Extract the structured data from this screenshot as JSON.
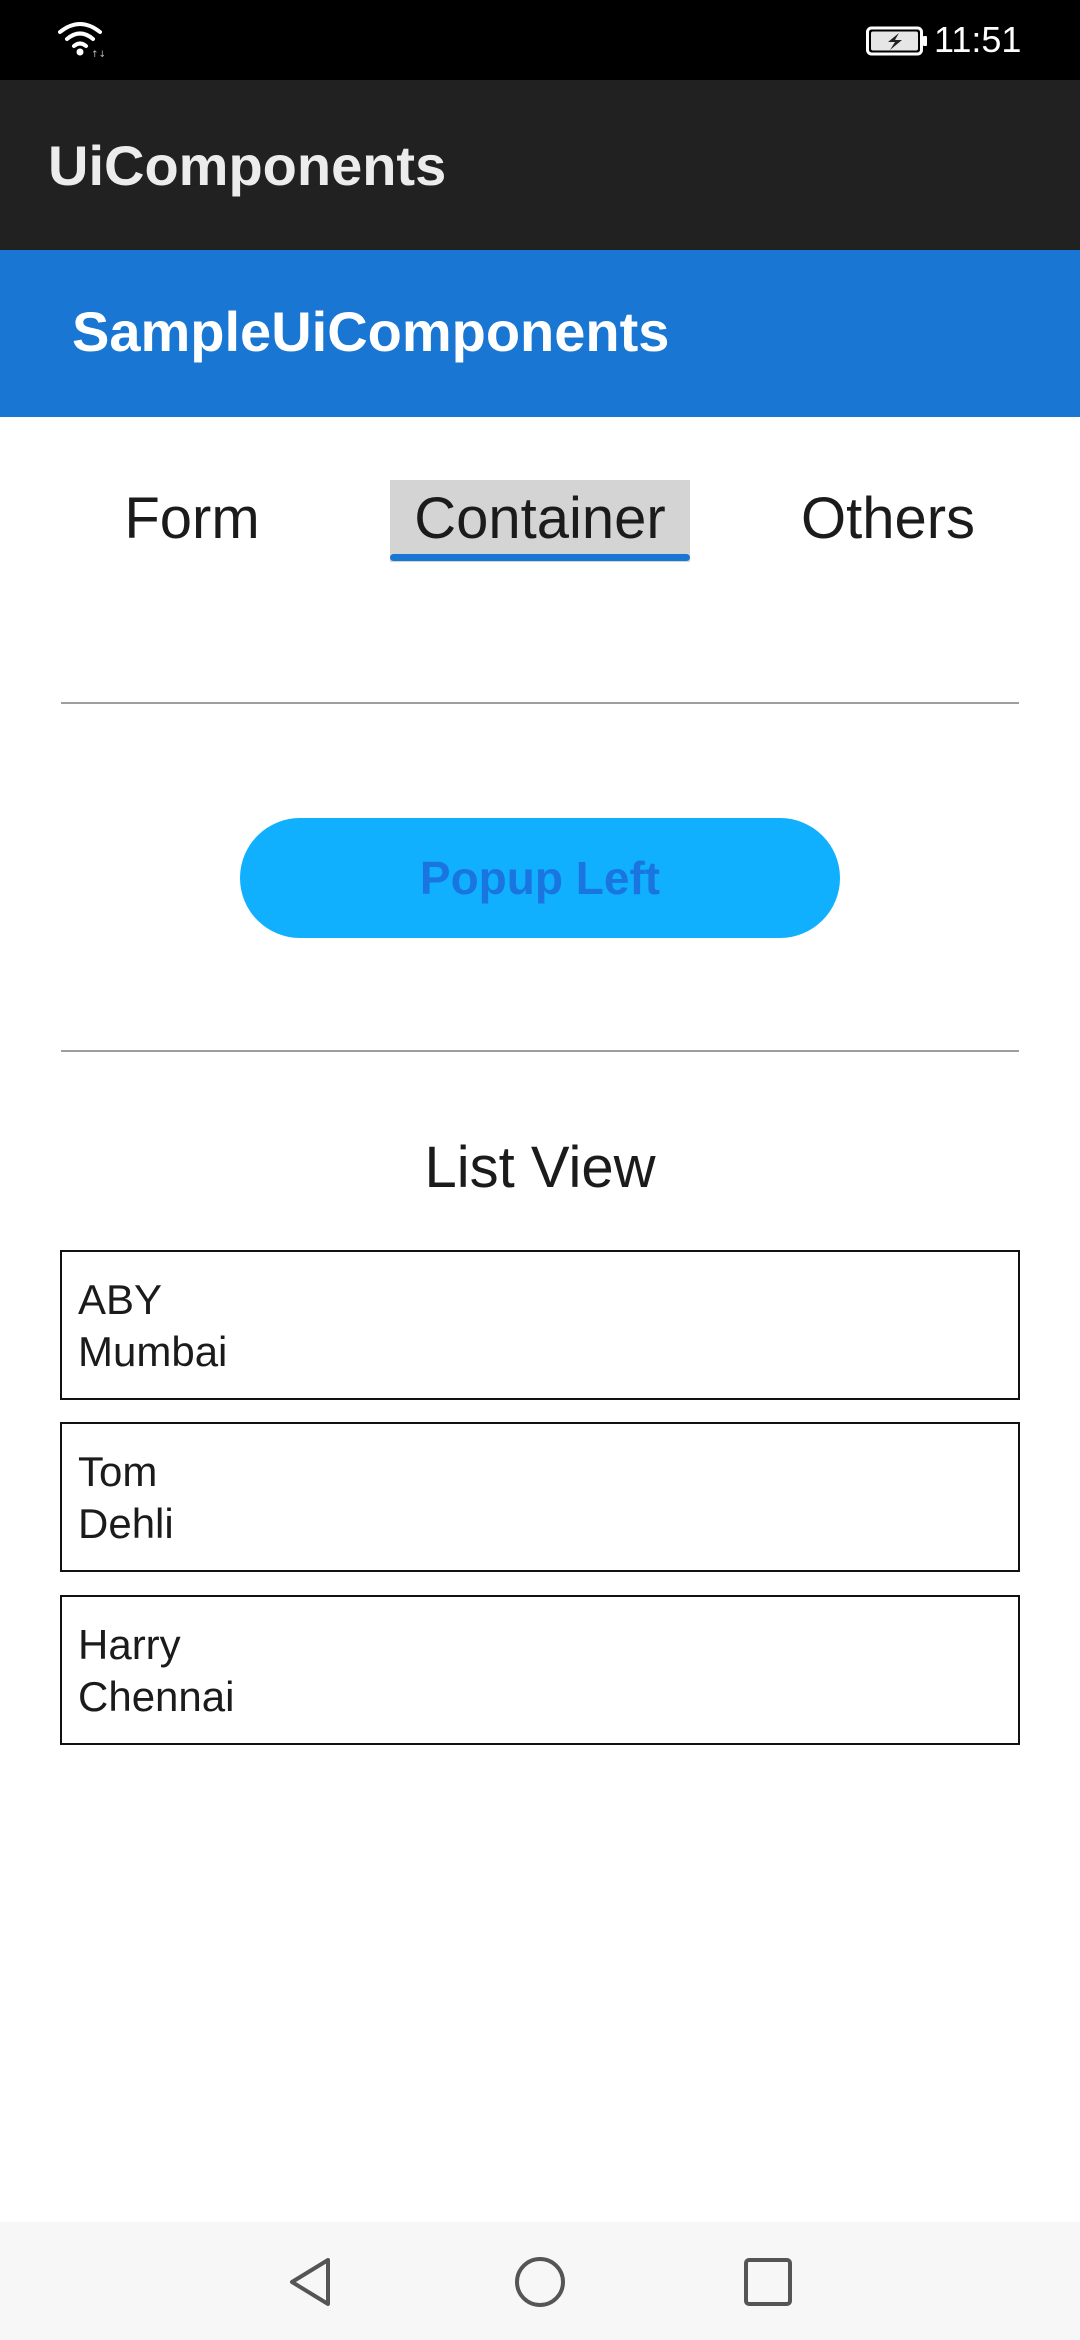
{
  "status_bar": {
    "time": "11:51",
    "icons": [
      "wifi-icon",
      "battery-charging-icon"
    ]
  },
  "app_bar": {
    "title": "UiComponents"
  },
  "header": {
    "title": "SampleUiComponents",
    "color": "#1976d2"
  },
  "tabs": [
    {
      "label": "Form",
      "selected": false
    },
    {
      "label": "Container",
      "selected": true
    },
    {
      "label": "Others",
      "selected": false
    }
  ],
  "popup_button": {
    "label": "Popup Left",
    "color": "#10b0ff",
    "text_color": "#1a75e0"
  },
  "list_view": {
    "heading": "List View",
    "items": [
      {
        "name": "ABY",
        "city": "Mumbai"
      },
      {
        "name": "Tom",
        "city": "Dehli"
      },
      {
        "name": "Harry",
        "city": "Chennai"
      }
    ]
  },
  "nav_bar": {
    "icons": [
      "back-icon",
      "home-icon",
      "recents-icon"
    ]
  }
}
